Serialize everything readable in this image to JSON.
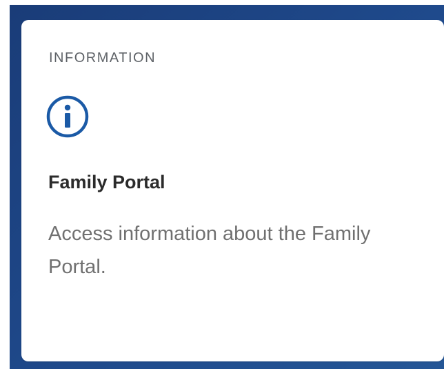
{
  "card": {
    "eyebrow": "INFORMATION",
    "icon": "info-circle-icon",
    "title": "Family Portal",
    "description": "Access information about the Family Portal."
  },
  "colors": {
    "background_blue": "#1f4a8c",
    "icon_blue": "#1b5aa6",
    "card_bg": "#ffffff",
    "eyebrow_text": "#5f6368",
    "title_text": "#2b2b2b",
    "description_text": "#707070"
  }
}
